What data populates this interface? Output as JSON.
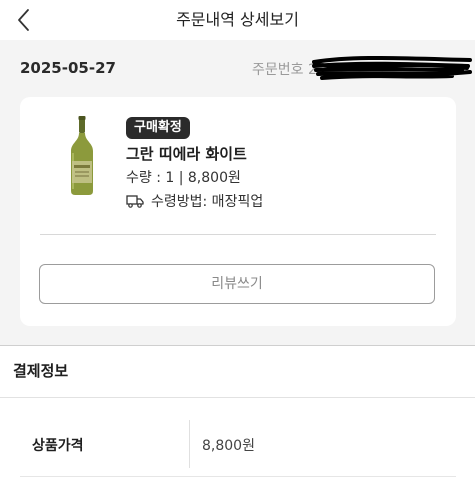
{
  "header": {
    "title": "주문내역 상세보기",
    "back_icon": "chevron-left-icon"
  },
  "order": {
    "date": "2025-05-27",
    "number_label": "주문번호 2"
  },
  "item": {
    "status": "구매확정",
    "name": "그란 띠에라 화이트",
    "qty_price": "수량 : 1 | 8,800원",
    "pickup": "수령방법: 매장픽업",
    "pickup_icon": "truck-icon",
    "image": "wine-bottle-image",
    "review_button": "리뷰쓰기"
  },
  "payment": {
    "section_title": "결제정보",
    "rows": [
      {
        "label": "상품가격",
        "value": "8,800원"
      }
    ]
  },
  "colors": {
    "badge_bg": "#2b2b2b",
    "page_gray": "#f4f4f4",
    "card_bg": "#ffffff"
  }
}
